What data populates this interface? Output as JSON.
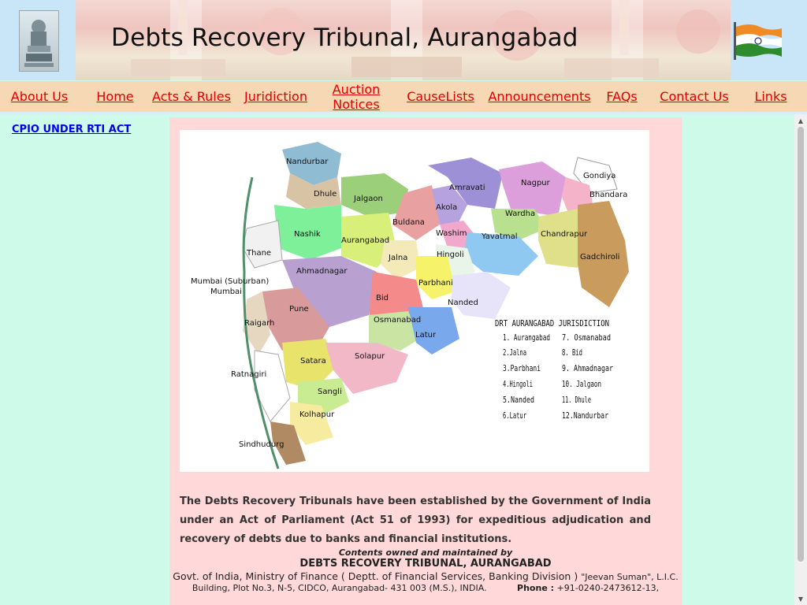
{
  "header": {
    "title": "Debts Recovery Tribunal, Aurangabad",
    "emblem_icon": "state-emblem-icon",
    "flag_icon": "indian-flag-icon"
  },
  "nav": {
    "items": [
      {
        "label": "About Us"
      },
      {
        "label": "Home"
      },
      {
        "label": "Acts & Rules"
      },
      {
        "label": "Juridiction"
      },
      {
        "label": "Auction Notices"
      },
      {
        "label": "CauseLists"
      },
      {
        "label": "Announcements"
      },
      {
        "label": "FAQs"
      },
      {
        "label": "Contact Us"
      },
      {
        "label": "Links"
      }
    ]
  },
  "sidebar": {
    "rti_link": "CPIO UNDER RTI ACT"
  },
  "map": {
    "districts": [
      "Nandurbar",
      "Dhule",
      "Jalgaon",
      "Nashik",
      "Aurangabad",
      "Jalna",
      "Buldana",
      "Akola",
      "Amravati",
      "Nagpur",
      "Gondiya",
      "Bhandara",
      "Wardha",
      "Washim",
      "Yavatmal",
      "Chandrapur",
      "Gadchiroli",
      "Hingoli",
      "Parbhani",
      "Nanded",
      "Thane",
      "Mumbai (Suburban)",
      "Mumbai",
      "Ahmadnagar",
      "Bid",
      "Pune",
      "Raigarh",
      "Osmanabad",
      "Latur",
      "Satara",
      "Solapur",
      "Ratnagiri",
      "Sangli",
      "Kolhapur",
      "Sindhudurg"
    ],
    "legend_title": "DRT AURANGABAD JURISDICTION",
    "legend_left": [
      "1. Aurangabad",
      "2.Jalna",
      "3.Parbhani",
      "4.Hingoli",
      "5.Nanded",
      "6.Latur"
    ],
    "legend_right": [
      "7. Osmanabad",
      "8. Bid",
      "9. Ahmadnagar",
      "10. Jalgaon",
      "11. Dhule",
      "12.Nandurbar"
    ]
  },
  "intro": "The Debts Recovery Tribunals have been established by the Government of India under an Act of Parliament (Act 51 of 1993) for expeditious adjudication and recovery of debts due to banks and financial institutions.",
  "footer": {
    "owned": "Contents owned and maintained by",
    "org": "DEBTS RECOVERY TRIBUNAL, AURANGABAD",
    "ministry": "Govt. of India, Ministry of Finance ( Deptt. of Financial Services, Banking Division )",
    "address_start": "\"Jeevan Suman\", L.I.C.",
    "address": "Building, Plot No.3, N-5, CIDCO, Aurangabad- 431 003 (M.S.), INDIA.",
    "phone_label": "Phone :",
    "phone": "+91-0240-2473612-13,"
  },
  "colors": {
    "nav_bg": "#f7d8b4",
    "nav_link": "#e00000",
    "sidebar_bg": "#cefbe9",
    "main_bg": "#ffd9d9",
    "header_bg": "#c9e6f8"
  }
}
